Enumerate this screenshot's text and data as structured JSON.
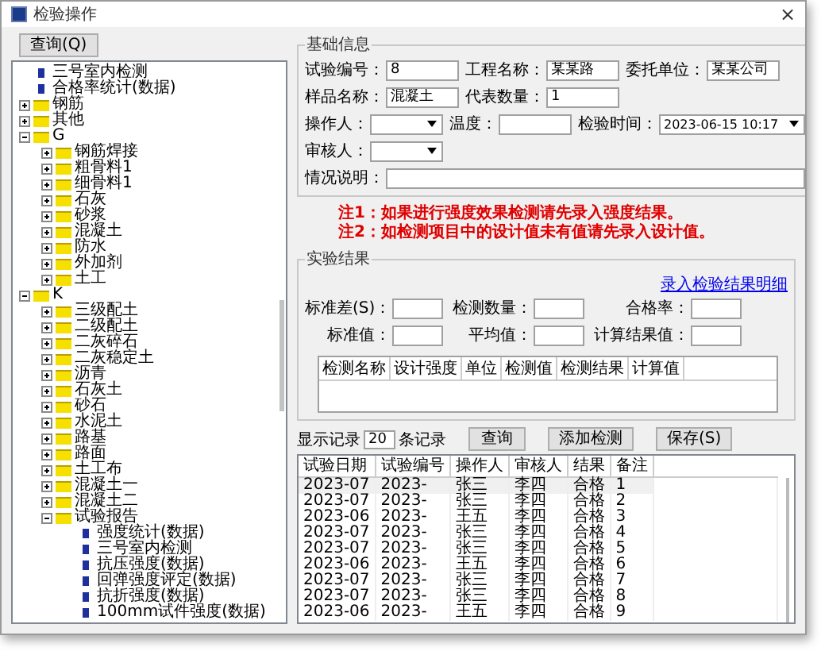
{
  "window": {
    "title": "检验操作",
    "close": "×"
  },
  "query_button": "查询(Q)",
  "tree": [
    {
      "label": "三号室内检测",
      "kind": "leaf"
    },
    {
      "label": "合格率统计(数据)",
      "kind": "leaf"
    },
    {
      "label": "钢筋",
      "kind": "folder",
      "expanded": false
    },
    {
      "label": "其他",
      "kind": "folder",
      "expanded": false
    },
    {
      "label": "G",
      "kind": "folder",
      "expanded": true,
      "children": [
        {
          "label": "钢筋焊接",
          "kind": "folder",
          "expanded": false
        },
        {
          "label": "粗骨料1",
          "kind": "folder",
          "expanded": false
        },
        {
          "label": "细骨料1",
          "kind": "folder",
          "expanded": false
        },
        {
          "label": "石灰",
          "kind": "folder",
          "expanded": false
        },
        {
          "label": "砂浆",
          "kind": "folder",
          "expanded": false
        },
        {
          "label": "混凝土",
          "kind": "folder",
          "expanded": false
        },
        {
          "label": "防水",
          "kind": "folder",
          "expanded": false
        },
        {
          "label": "外加剂",
          "kind": "folder",
          "expanded": false
        },
        {
          "label": "土工",
          "kind": "folder",
          "expanded": false
        }
      ]
    },
    {
      "label": "K",
      "kind": "folder",
      "expanded": true,
      "children": [
        {
          "label": "三级配土",
          "kind": "folder",
          "expanded": false
        },
        {
          "label": "二级配土",
          "kind": "folder",
          "expanded": false
        },
        {
          "label": "二灰碎石",
          "kind": "folder",
          "expanded": false
        },
        {
          "label": "二灰稳定土",
          "kind": "folder",
          "expanded": false
        },
        {
          "label": "沥青",
          "kind": "folder",
          "expanded": false
        },
        {
          "label": "石灰土",
          "kind": "folder",
          "expanded": false
        },
        {
          "label": "砂石",
          "kind": "folder",
          "expanded": false
        },
        {
          "label": "水泥土",
          "kind": "folder",
          "expanded": false
        },
        {
          "label": "路基",
          "kind": "folder",
          "expanded": false
        },
        {
          "label": "路面",
          "kind": "folder",
          "expanded": false
        },
        {
          "label": "土工布",
          "kind": "folder",
          "expanded": false
        },
        {
          "label": "混凝土一",
          "kind": "folder",
          "expanded": false
        },
        {
          "label": "混凝土二",
          "kind": "folder",
          "expanded": false
        },
        {
          "label": "试验报告",
          "kind": "folder",
          "expanded": true,
          "children": [
            {
              "label": "强度统计(数据)",
              "kind": "leaf"
            },
            {
              "label": "三号室内检测",
              "kind": "leaf"
            },
            {
              "label": "抗压强度(数据)",
              "kind": "leaf"
            },
            {
              "label": "回弹强度评定(数据)",
              "kind": "leaf"
            },
            {
              "label": "抗折强度(数据)",
              "kind": "leaf"
            },
            {
              "label": "100mm试件强度(数据)",
              "kind": "leaf"
            }
          ]
        }
      ]
    }
  ],
  "basic": {
    "title": "基础信息",
    "field_rows": [
      [
        {
          "label": "试验编号：",
          "value": "8",
          "kind": "text"
        },
        {
          "label": "工程名称：",
          "value": "某某路",
          "kind": "text"
        },
        {
          "label": "委托单位：",
          "value": "某某公司",
          "kind": "text"
        }
      ],
      [
        {
          "label": "样品名称：",
          "value": "混凝土",
          "kind": "text"
        },
        {
          "label": "代表数量：",
          "value": "1",
          "kind": "text"
        }
      ],
      [
        {
          "label": "操作人：",
          "kind": "dropdown"
        },
        {
          "label": "温度：",
          "kind": "text"
        },
        {
          "label": "检验时间：",
          "value": "2023-06-15 10:17",
          "kind": "dropdown"
        }
      ],
      [
        {
          "label": "审核人：",
          "kind": "dropdown"
        }
      ],
      [
        {
          "label": "情况说明：",
          "kind": "wide"
        }
      ]
    ]
  },
  "notes": [
    "注1：如果进行强度效果检测请先录入强度结果。",
    "注2：如检测项目中的设计值未有值请先录入设计值。"
  ],
  "results": {
    "title": "实验结果",
    "link": "录入检验结果明细",
    "fields": [
      {
        "label": "标准差(S)："
      },
      {
        "label": "检测数量："
      },
      {
        "label": "合格率："
      },
      {
        "label": "标准值："
      },
      {
        "label": "平均值："
      },
      {
        "label": "计算结果值："
      }
    ],
    "columns": [
      "检测名称",
      "设计强度",
      "单位",
      "检测值",
      "检测结果",
      "计算值"
    ]
  },
  "toolbar": {
    "show_label": "显示记录",
    "count": "20",
    "unit": "条记录",
    "buttons": [
      "查询",
      "添加检测",
      "保存(S)"
    ]
  },
  "records": {
    "columns": [
      "试验日期",
      "试验编号",
      "操作人",
      "审核人",
      "结果",
      "备注"
    ],
    "rows": [
      [
        "2023-07",
        "2023-",
        "张三",
        "李四",
        "合格",
        "1"
      ],
      [
        "2023-07",
        "2023-",
        "张三",
        "李四",
        "合格",
        "2"
      ],
      [
        "2023-06",
        "2023-",
        "王五",
        "李四",
        "合格",
        "3"
      ],
      [
        "2023-07",
        "2023-",
        "张三",
        "李四",
        "合格",
        "4"
      ],
      [
        "2023-07",
        "2023-",
        "张三",
        "李四",
        "合格",
        "5"
      ],
      [
        "2023-06",
        "2023-",
        "王五",
        "李四",
        "合格",
        "6"
      ],
      [
        "2023-07",
        "2023-",
        "张三",
        "李四",
        "合格",
        "7"
      ],
      [
        "2023-07",
        "2023-",
        "张三",
        "李四",
        "合格",
        "8"
      ],
      [
        "2023-06",
        "2023-",
        "王五",
        "李四",
        "合格",
        "9"
      ]
    ]
  }
}
